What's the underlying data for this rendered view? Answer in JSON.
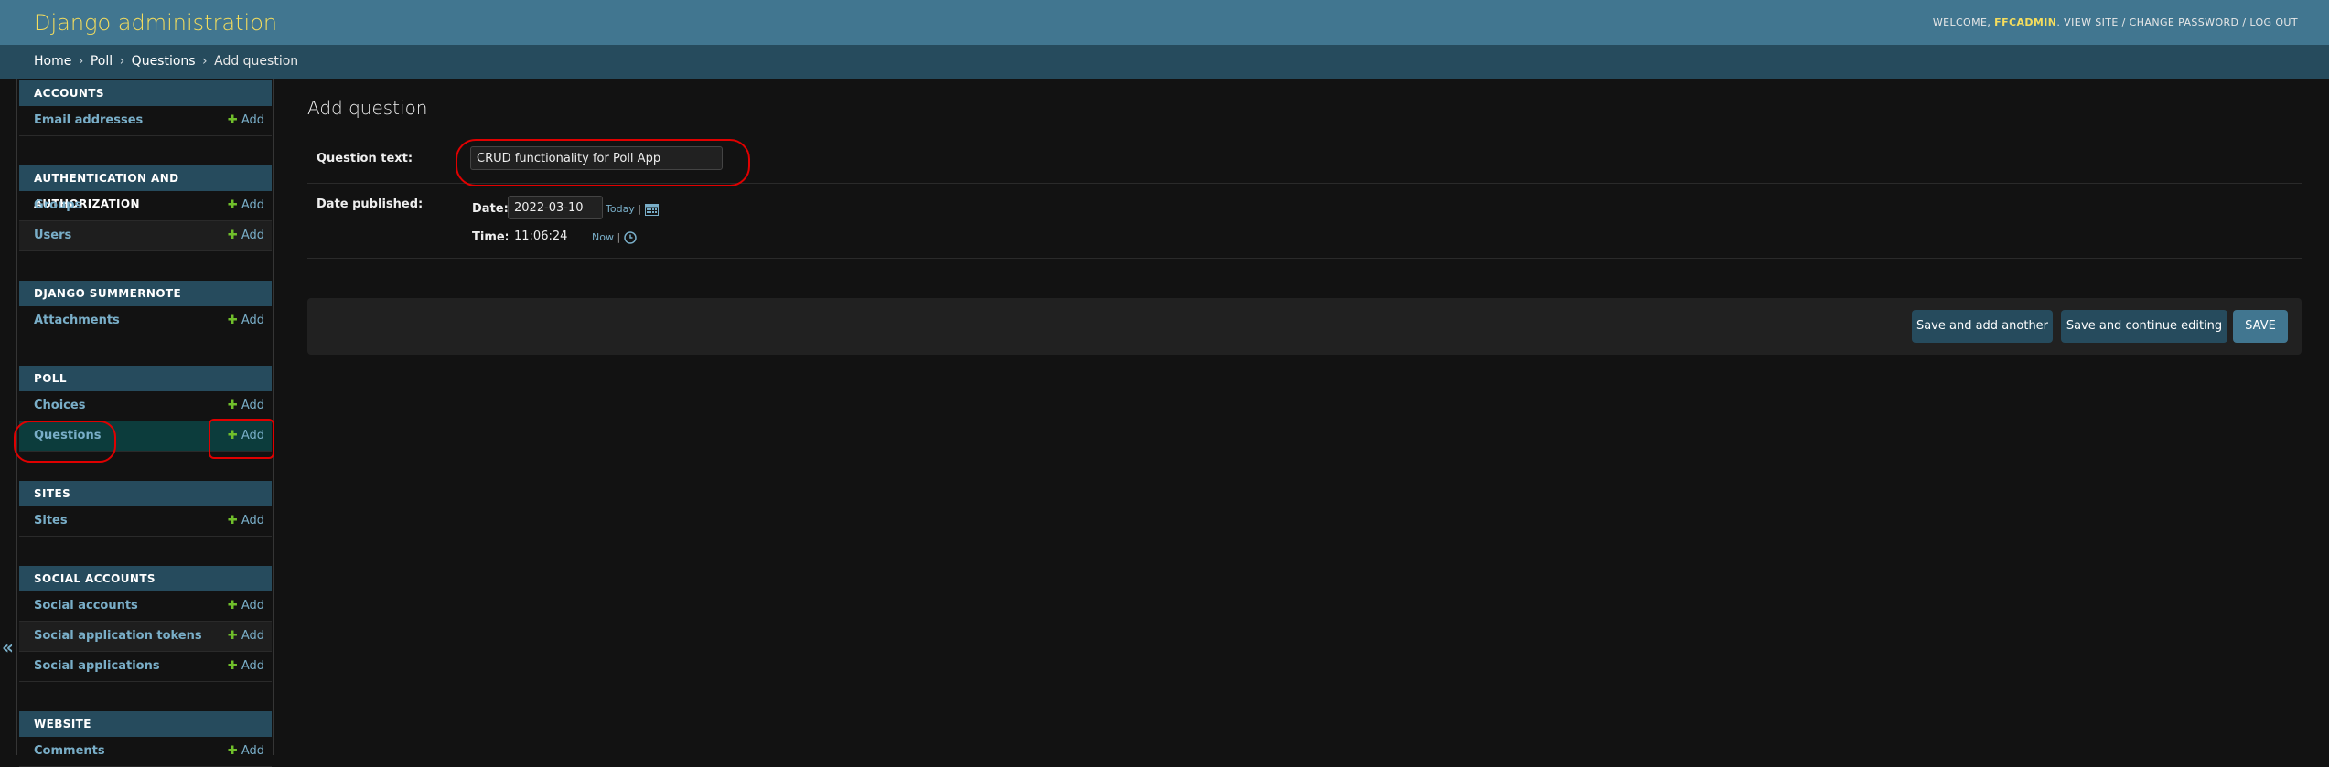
{
  "header": {
    "site_name": "Django administration",
    "welcome": "WELCOME,",
    "username": "FFCADMIN",
    "view_site": "VIEW SITE",
    "change_password": "CHANGE PASSWORD",
    "log_out": "LOG OUT",
    "separator": "/"
  },
  "breadcrumbs": {
    "home": "Home",
    "app": "Poll",
    "model": "Questions",
    "current": "Add question",
    "sep": "›"
  },
  "sidebar": {
    "add_label": "Add",
    "collapse_glyph": "«",
    "modules": [
      {
        "caption": "ACCOUNTS",
        "items": [
          "Email addresses"
        ]
      },
      {
        "caption": "AUTHENTICATION AND AUTHORIZATION",
        "items": [
          "Groups",
          "Users"
        ]
      },
      {
        "caption": "DJANGO SUMMERNOTE",
        "items": [
          "Attachments"
        ]
      },
      {
        "caption": "POLL",
        "items": [
          "Choices",
          "Questions"
        ]
      },
      {
        "caption": "SITES",
        "items": [
          "Sites"
        ]
      },
      {
        "caption": "SOCIAL ACCOUNTS",
        "items": [
          "Social accounts",
          "Social application tokens",
          "Social applications"
        ]
      },
      {
        "caption": "WEBSITE",
        "items": [
          "Comments"
        ]
      }
    ]
  },
  "form": {
    "title": "Add question",
    "question_text_label": "Question text:",
    "question_text_value": "CRUD functionality for Poll App",
    "date_published_label": "Date published:",
    "date_label": "Date:",
    "date_value": "2022-03-10",
    "today_link": "Today",
    "time_label": "Time:",
    "time_value": "11:06:24",
    "now_link": "Now",
    "shortcut_sep": "|"
  },
  "buttons": {
    "save_add_another": "Save and add another",
    "save_continue": "Save and continue editing",
    "save": "SAVE"
  },
  "colors": {
    "header_bg": "#417690",
    "branding": "#f5dd5d",
    "link": "#79aec8",
    "add_plus": "#70bf2b",
    "annotation": "#e00000"
  }
}
